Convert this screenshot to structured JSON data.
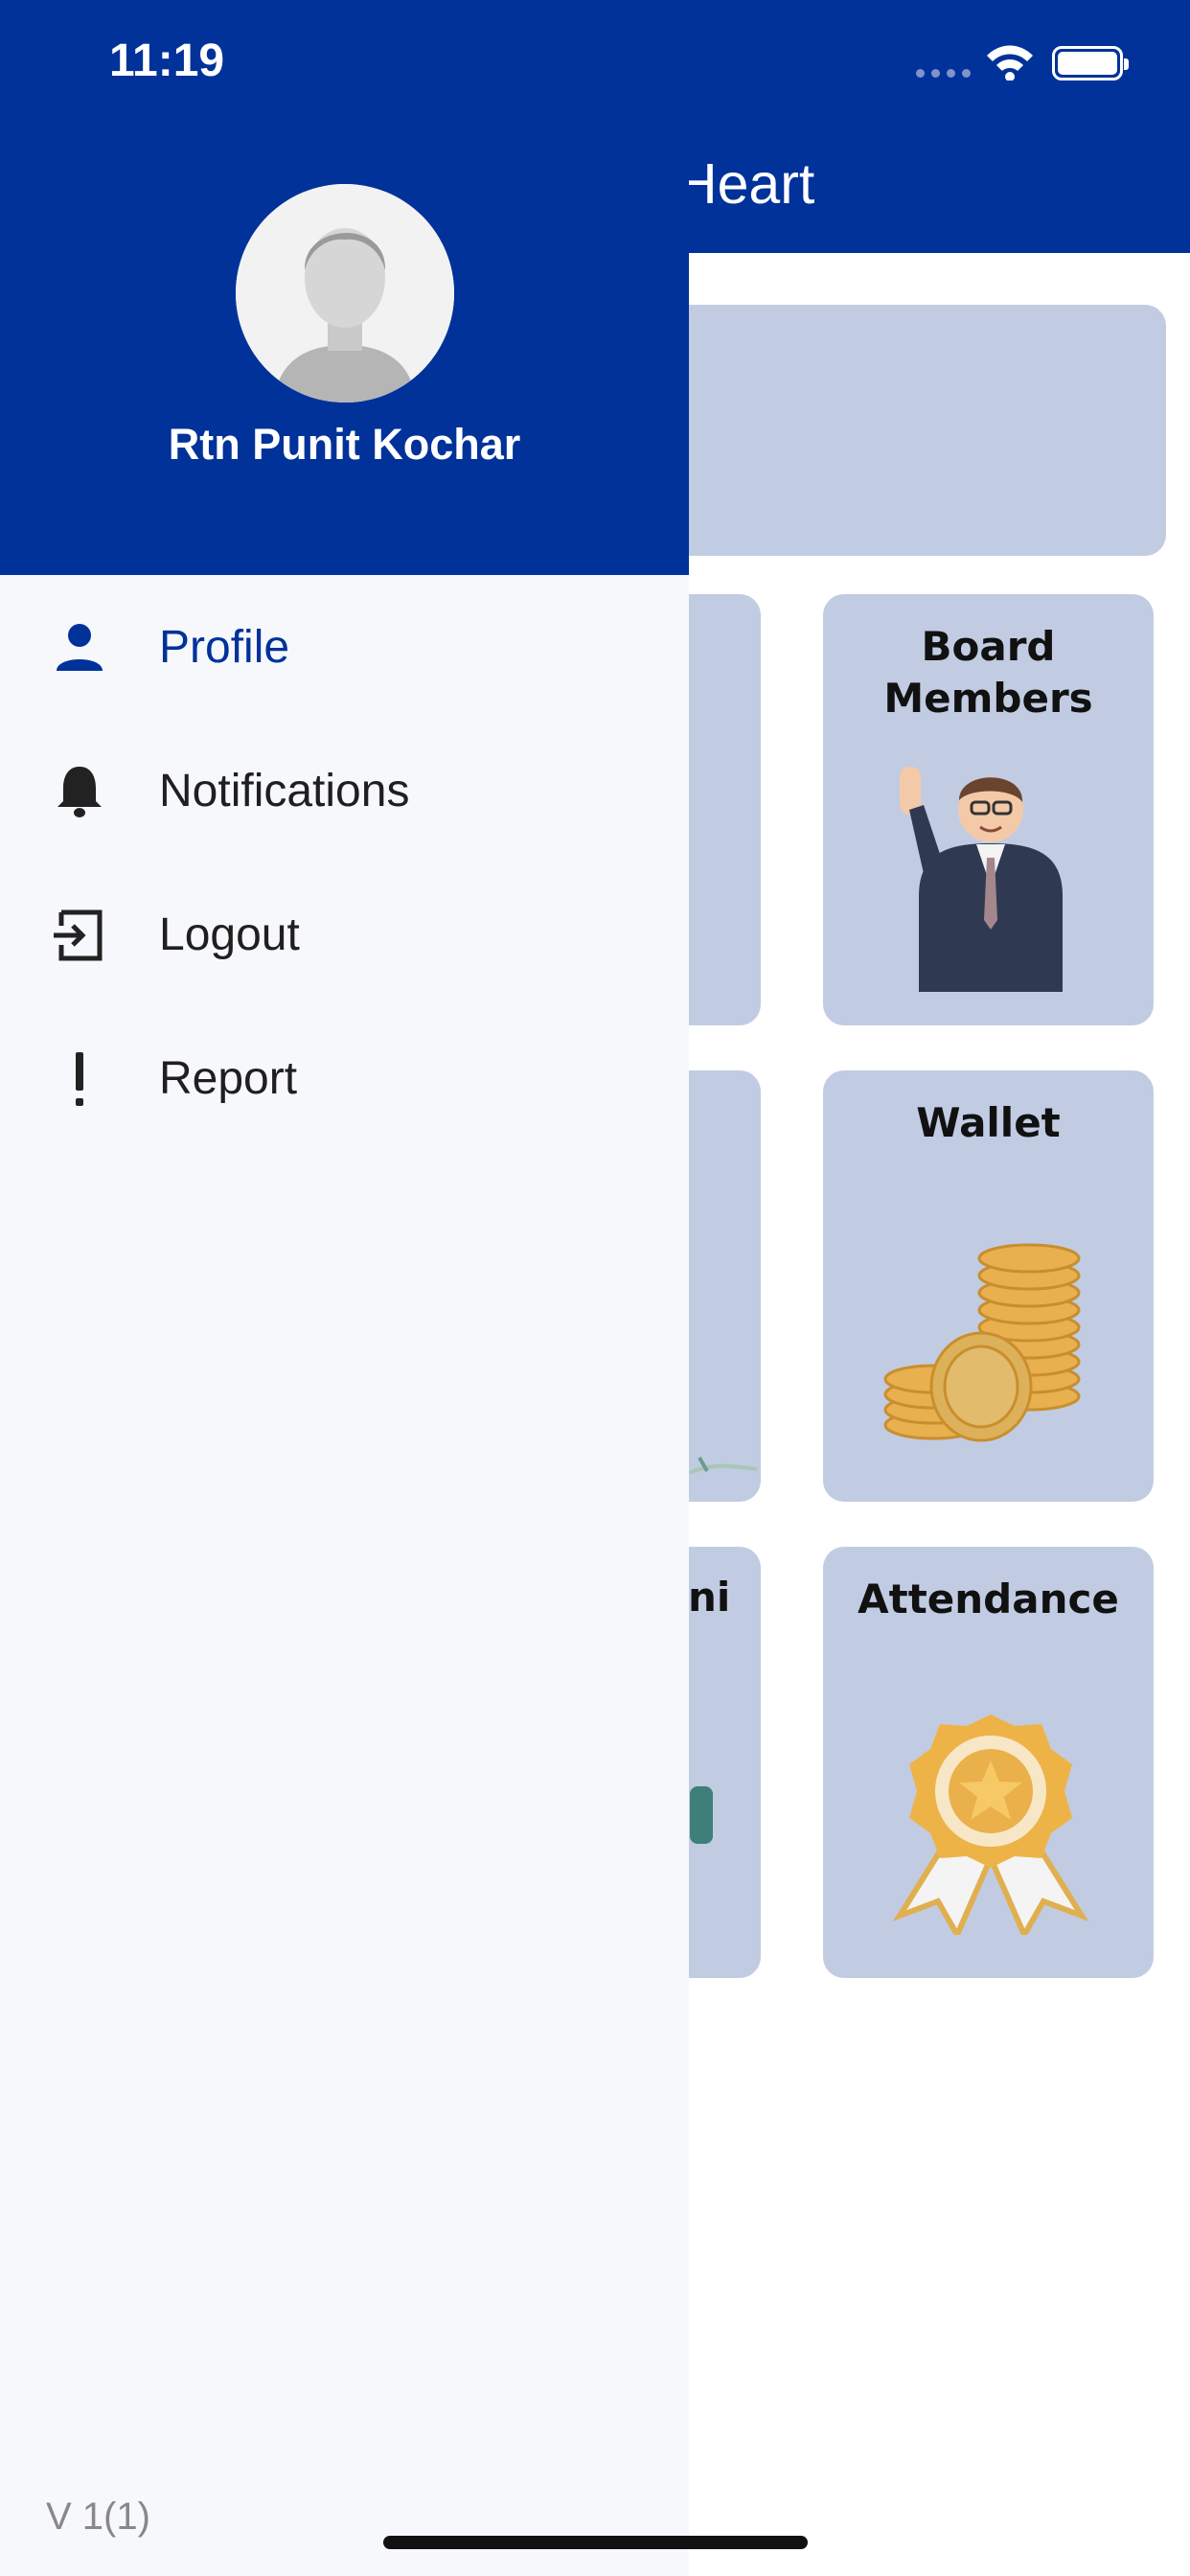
{
  "status_bar": {
    "time": "11:19"
  },
  "header": {
    "title_visible": "Heart"
  },
  "tiles": [
    {
      "label": "",
      "label_fragment": ""
    },
    {
      "label": "Board\nMembers"
    },
    {
      "label": ""
    },
    {
      "label": "Wallet"
    },
    {
      "label_fragment": "ni"
    },
    {
      "label": "Attendance"
    }
  ],
  "drawer": {
    "user_name": "Rtn Punit Kochar",
    "menu": [
      {
        "label": "Profile",
        "icon": "person-icon",
        "active": true
      },
      {
        "label": "Notifications",
        "icon": "bell-icon",
        "active": false
      },
      {
        "label": "Logout",
        "icon": "logout-icon",
        "active": false
      },
      {
        "label": "Report",
        "icon": "exclamation-icon",
        "active": false
      }
    ],
    "version": "V 1(1)"
  },
  "colors": {
    "primary": "#00329a",
    "tile_bg": "#c1cce3",
    "drawer_bg": "#f7f8fb"
  }
}
